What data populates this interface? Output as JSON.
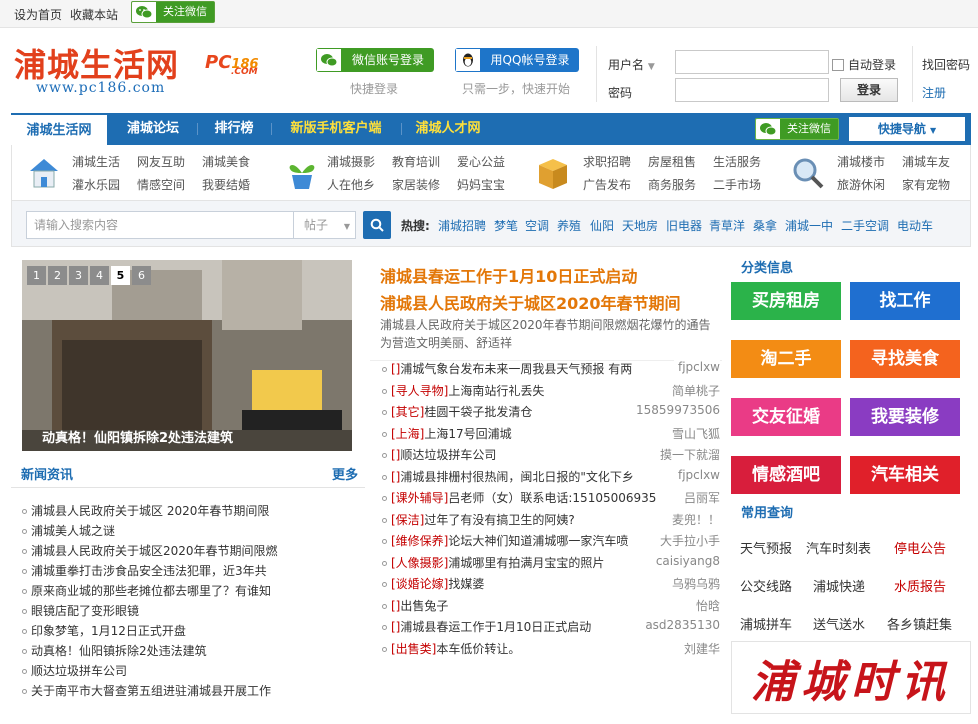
{
  "topbar": {
    "set_home": "设为首页",
    "bookmark": "收藏本站",
    "follow_wechat": "关注微信"
  },
  "logo": {
    "title": "浦城生活网",
    "brand_pc": "PC",
    "brand_num": "186",
    "brand_com": ".COM",
    "url": "www.pc186.com"
  },
  "login": {
    "wechat_btn": "微信账号登录",
    "wechat_hint": "快捷登录",
    "qq_btn": "用QQ帐号登录",
    "qq_hint": "只需一步，快速开始",
    "username_label": "用户名",
    "password_label": "密码",
    "auto_login": "自动登录",
    "login_btn": "登录",
    "forgot": "找回密码",
    "register": "注册"
  },
  "nav": {
    "items": [
      "浦城生活网",
      "浦城论坛",
      "排行榜",
      "新版手机客户端",
      "浦城人才网"
    ],
    "follow_wechat": "关注微信",
    "quick_nav": "快捷导航"
  },
  "links": {
    "g1": [
      "浦城生活",
      "网友互助",
      "浦城美食",
      "灌水乐园",
      "情感空间",
      "我要结婚"
    ],
    "g2": [
      "浦城摄影",
      "教育培训",
      "爱心公益",
      "人在他乡",
      "家居装修",
      "妈妈宝宝"
    ],
    "g3": [
      "求职招聘",
      "房屋租售",
      "生活服务",
      "广告发布",
      "商务服务",
      "二手市场"
    ],
    "g4": [
      "浦城楼市",
      "浦城车友",
      "旅游休闲",
      "家有宠物"
    ]
  },
  "search": {
    "placeholder": "请输入搜索内容",
    "type": "帖子",
    "hot_label": "热搜:",
    "hot": [
      "浦城招聘",
      "梦笔",
      "空调",
      "养殖",
      "仙阳",
      "天地房",
      "旧电器",
      "青草洋",
      "桑拿",
      "浦城一中",
      "二手空调",
      "电动车"
    ]
  },
  "slider": {
    "pages": [
      "1",
      "2",
      "3",
      "4",
      "5",
      "6"
    ],
    "active": "5",
    "caption": "动真格！仙阳镇拆除2处违法建筑"
  },
  "news": {
    "title": "新闻资讯",
    "more": "更多",
    "items": [
      "浦城县人民政府关于城区 2020年春节期间限",
      "浦城美人城之谜",
      "浦城县人民政府关于城区2020年春节期间限燃",
      "浦城重拳打击涉食品安全违法犯罪，近3年共",
      "原来商业城的那些老摊位都去哪里了？有谁知",
      "眼镜店配了变形眼镜",
      "印象梦笔，1月12日正式开盘",
      "动真格！仙阳镇拆除2处违法建筑",
      "顺达垃圾拼车公司",
      "关于南平市大督查第五组进驻浦城县开展工作"
    ]
  },
  "headlines": {
    "h1": "浦城县春运工作于1月10日正式启动",
    "h2": "浦城县人民政府关于城区2020年春节期间",
    "summary": "浦城县人民政府关于城区2020年春节期间限燃烟花爆竹的通告为营造文明美丽、舒适祥"
  },
  "posts": [
    {
      "tag": "[]",
      "text": "浦城气象台发布未来一周我县天气预报 有两",
      "author": "fjpclxw"
    },
    {
      "tag": "[寻人寻物]",
      "text": "上海南站行礼丢失",
      "author": "简单桃子"
    },
    {
      "tag": "[其它]",
      "text": "桂圆干袋子批发清仓",
      "author": "15859973506"
    },
    {
      "tag": "[上海]",
      "text": "上海17号回浦城",
      "author": "雪山飞狐"
    },
    {
      "tag": "[]",
      "text": "顺达垃圾拼车公司",
      "author": "摸一下就溜"
    },
    {
      "tag": "[]",
      "text": "浦城县排栅村很热闹，闽北日报的\"文化下乡",
      "author": "fjpclxw"
    },
    {
      "tag": "[课外辅导]",
      "text": "吕老师（女）联系电话:15105006935",
      "author": "吕丽军"
    },
    {
      "tag": "[保洁]",
      "text": "过年了有没有搞卫生的阿姨?",
      "author": "麦兜！！"
    },
    {
      "tag": "[维修保养]",
      "text": "论坛大神们知道浦城哪一家汽车喷",
      "author": "大手拉小手"
    },
    {
      "tag": "[人像摄影]",
      "text": "浦城哪里有拍满月宝宝的照片",
      "author": "caisiyang8"
    },
    {
      "tag": "[谈婚论嫁]",
      "text": "找媒婆",
      "author": "乌鸦乌鸦"
    },
    {
      "tag": "[]",
      "text": "出售兔子",
      "author": "怡晗"
    },
    {
      "tag": "[]",
      "text": "浦城县春运工作于1月10日正式启动",
      "author": "asd2835130"
    },
    {
      "tag": "[出售类]",
      "text": "本车低价转让。",
      "author": "刘建华"
    }
  ],
  "categories": {
    "title": "分类信息",
    "items": [
      {
        "label": "买房租房",
        "color": "#2bb34a"
      },
      {
        "label": "找工作",
        "color": "#1f6fd0"
      },
      {
        "label": "淘二手",
        "color": "#f38c14"
      },
      {
        "label": "寻找美食",
        "color": "#f4631e"
      },
      {
        "label": "交友征婚",
        "color": "#ea3b86"
      },
      {
        "label": "我要装修",
        "color": "#8a3cc2"
      },
      {
        "label": "情感酒吧",
        "color": "#d81e3c"
      },
      {
        "label": "汽车相关",
        "color": "#e0202a"
      }
    ]
  },
  "quick": {
    "title": "常用查询",
    "items": [
      "天气预报",
      "汽车时刻表",
      "停电公告",
      "公交线路",
      "浦城快递",
      "水质报告",
      "浦城拼车",
      "送气送水",
      "各乡镇赶集"
    ]
  },
  "stamp": "浦城时讯",
  "colors": {
    "primary": "#1e6db2",
    "logo": "#e2401c",
    "headline": "#e37708",
    "tag": "#c40000",
    "wechat": "#3f9b24"
  }
}
